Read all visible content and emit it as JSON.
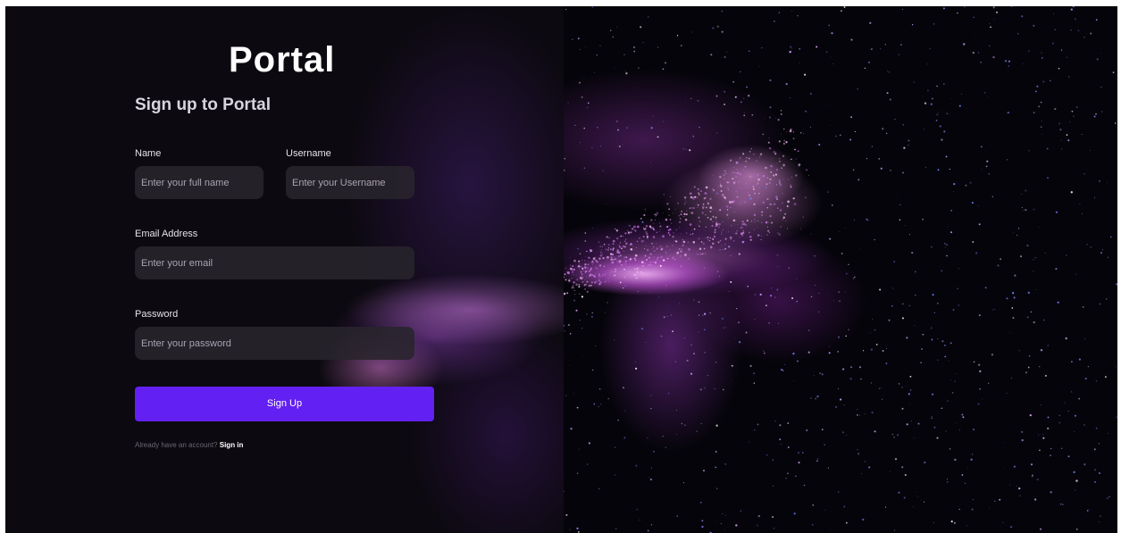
{
  "brand": {
    "logo_text": "Portal"
  },
  "form": {
    "title": "Sign up to Portal",
    "name": {
      "label": "Name",
      "placeholder": "Enter your full name"
    },
    "username": {
      "label": "Username",
      "placeholder": "Enter your Username"
    },
    "email": {
      "label": "Email Address",
      "placeholder": "Enter your email"
    },
    "password": {
      "label": "Password",
      "placeholder": "Enter your password"
    },
    "submit_label": "Sign Up",
    "footer_text": "Already have an account?",
    "signin_link": "Sign in"
  },
  "colors": {
    "accent": "#6320f2",
    "background": "#0c0910",
    "field_bg": "#28242c"
  },
  "icons": [
    "portal-o-icon"
  ]
}
